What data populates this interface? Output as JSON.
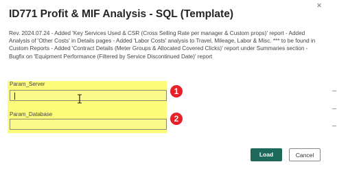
{
  "dialog": {
    "title": "ID771 Profit & MIF Analysis - SQL (Template)",
    "close_glyph": "×",
    "description": "Rev. 2024.07.24 - Added 'Key Services Used & CSR (Cross Selling Rate per manager & Custom props)' report - Added Analysis of 'Other Costs' in Details pages - Added 'Labor Costs' analysis to Travel, Mileage, Labor & Misc. *** to be found in Custom Reports - Added 'Contract Details (Meter Groups & Allocated Covered Clicks)' report under Summaries section - Bugfix on 'Equipment Performance (Filtered by Service Discontinued Date)' report"
  },
  "params": {
    "server": {
      "label": "Param_Server",
      "value": ""
    },
    "database": {
      "label": "Param_Database",
      "value": ""
    }
  },
  "markers": {
    "one": "1",
    "two": "2"
  },
  "buttons": {
    "load": "Load",
    "cancel": "Cancel"
  },
  "colors": {
    "highlight": "#fdfb7a",
    "marker": "#e8202a",
    "primary": "#1e6a5a"
  }
}
